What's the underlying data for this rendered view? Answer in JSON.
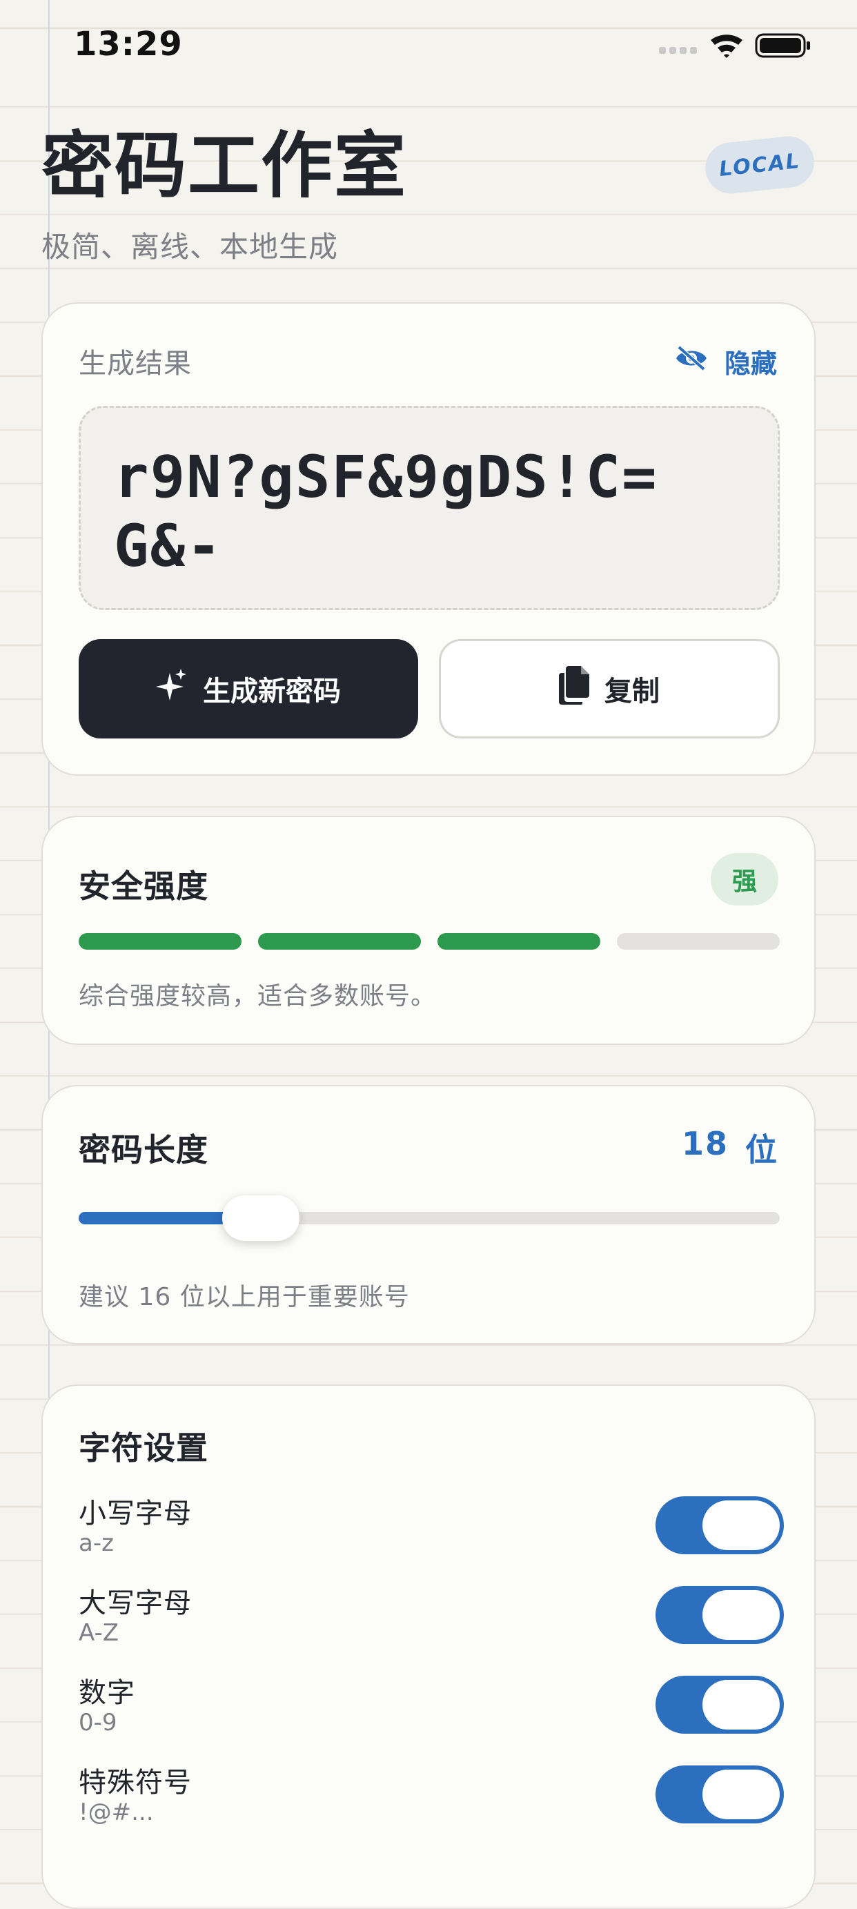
{
  "status_bar": {
    "time": "13:29"
  },
  "header": {
    "title": "密码工作室",
    "subtitle": "极简、离线、本地生成",
    "badge": "LOCAL"
  },
  "result": {
    "label": "生成结果",
    "hide_label": "隐藏",
    "password": "r9N?gSF&9gDS!C=G&-",
    "generate_label": "生成新密码",
    "copy_label": "复制"
  },
  "strength": {
    "title": "安全强度",
    "level": "强",
    "segments_total": 4,
    "segments_filled": 3,
    "description": "综合强度较高，适合多数账号。"
  },
  "length": {
    "title": "密码长度",
    "value": "18",
    "unit": "位",
    "slider_fraction": 0.26,
    "hint": "建议 16 位以上用于重要账号"
  },
  "characters": {
    "title": "字符设置",
    "options": [
      {
        "label": "小写字母",
        "sub": "a-z",
        "enabled": true
      },
      {
        "label": "大写字母",
        "sub": "A-Z",
        "enabled": true
      },
      {
        "label": "数字",
        "sub": "0-9",
        "enabled": true
      },
      {
        "label": "特殊符号",
        "sub": "!@#...",
        "enabled": true
      }
    ]
  },
  "colors": {
    "accent": "#2c6fbf",
    "strong": "#2d9a50",
    "dark_button": "#22242e"
  }
}
